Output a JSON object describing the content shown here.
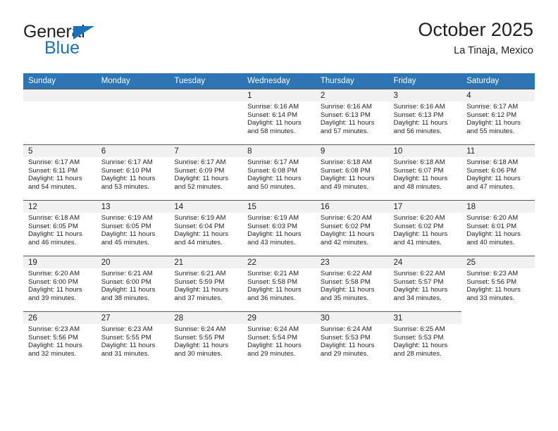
{
  "brand": {
    "name_top": "General",
    "name_bottom": "Blue",
    "accent_color": "#1b72b8"
  },
  "header": {
    "title": "October 2025",
    "subtitle": "La Tinaja, Mexico"
  },
  "theme": {
    "header_row_bg": "#2e75b6",
    "daynum_band_bg": "#f1f1f1",
    "cell_border": "#58595b",
    "text_color": "#231f20"
  },
  "weekdays": [
    "Sunday",
    "Monday",
    "Tuesday",
    "Wednesday",
    "Thursday",
    "Friday",
    "Saturday"
  ],
  "weeks": [
    [
      {
        "day": "",
        "sunrise": "",
        "sunset": "",
        "daylight_line1": "",
        "daylight_line2": "",
        "empty": true
      },
      {
        "day": "",
        "sunrise": "",
        "sunset": "",
        "daylight_line1": "",
        "daylight_line2": "",
        "empty": true
      },
      {
        "day": "",
        "sunrise": "",
        "sunset": "",
        "daylight_line1": "",
        "daylight_line2": "",
        "empty": true
      },
      {
        "day": "1",
        "sunrise": "Sunrise: 6:16 AM",
        "sunset": "Sunset: 6:14 PM",
        "daylight_line1": "Daylight: 11 hours",
        "daylight_line2": "and 58 minutes."
      },
      {
        "day": "2",
        "sunrise": "Sunrise: 6:16 AM",
        "sunset": "Sunset: 6:13 PM",
        "daylight_line1": "Daylight: 11 hours",
        "daylight_line2": "and 57 minutes."
      },
      {
        "day": "3",
        "sunrise": "Sunrise: 6:16 AM",
        "sunset": "Sunset: 6:13 PM",
        "daylight_line1": "Daylight: 11 hours",
        "daylight_line2": "and 56 minutes."
      },
      {
        "day": "4",
        "sunrise": "Sunrise: 6:17 AM",
        "sunset": "Sunset: 6:12 PM",
        "daylight_line1": "Daylight: 11 hours",
        "daylight_line2": "and 55 minutes."
      }
    ],
    [
      {
        "day": "5",
        "sunrise": "Sunrise: 6:17 AM",
        "sunset": "Sunset: 6:11 PM",
        "daylight_line1": "Daylight: 11 hours",
        "daylight_line2": "and 54 minutes."
      },
      {
        "day": "6",
        "sunrise": "Sunrise: 6:17 AM",
        "sunset": "Sunset: 6:10 PM",
        "daylight_line1": "Daylight: 11 hours",
        "daylight_line2": "and 53 minutes."
      },
      {
        "day": "7",
        "sunrise": "Sunrise: 6:17 AM",
        "sunset": "Sunset: 6:09 PM",
        "daylight_line1": "Daylight: 11 hours",
        "daylight_line2": "and 52 minutes."
      },
      {
        "day": "8",
        "sunrise": "Sunrise: 6:17 AM",
        "sunset": "Sunset: 6:08 PM",
        "daylight_line1": "Daylight: 11 hours",
        "daylight_line2": "and 50 minutes."
      },
      {
        "day": "9",
        "sunrise": "Sunrise: 6:18 AM",
        "sunset": "Sunset: 6:08 PM",
        "daylight_line1": "Daylight: 11 hours",
        "daylight_line2": "and 49 minutes."
      },
      {
        "day": "10",
        "sunrise": "Sunrise: 6:18 AM",
        "sunset": "Sunset: 6:07 PM",
        "daylight_line1": "Daylight: 11 hours",
        "daylight_line2": "and 48 minutes."
      },
      {
        "day": "11",
        "sunrise": "Sunrise: 6:18 AM",
        "sunset": "Sunset: 6:06 PM",
        "daylight_line1": "Daylight: 11 hours",
        "daylight_line2": "and 47 minutes."
      }
    ],
    [
      {
        "day": "12",
        "sunrise": "Sunrise: 6:18 AM",
        "sunset": "Sunset: 6:05 PM",
        "daylight_line1": "Daylight: 11 hours",
        "daylight_line2": "and 46 minutes."
      },
      {
        "day": "13",
        "sunrise": "Sunrise: 6:19 AM",
        "sunset": "Sunset: 6:05 PM",
        "daylight_line1": "Daylight: 11 hours",
        "daylight_line2": "and 45 minutes."
      },
      {
        "day": "14",
        "sunrise": "Sunrise: 6:19 AM",
        "sunset": "Sunset: 6:04 PM",
        "daylight_line1": "Daylight: 11 hours",
        "daylight_line2": "and 44 minutes."
      },
      {
        "day": "15",
        "sunrise": "Sunrise: 6:19 AM",
        "sunset": "Sunset: 6:03 PM",
        "daylight_line1": "Daylight: 11 hours",
        "daylight_line2": "and 43 minutes."
      },
      {
        "day": "16",
        "sunrise": "Sunrise: 6:20 AM",
        "sunset": "Sunset: 6:02 PM",
        "daylight_line1": "Daylight: 11 hours",
        "daylight_line2": "and 42 minutes."
      },
      {
        "day": "17",
        "sunrise": "Sunrise: 6:20 AM",
        "sunset": "Sunset: 6:02 PM",
        "daylight_line1": "Daylight: 11 hours",
        "daylight_line2": "and 41 minutes."
      },
      {
        "day": "18",
        "sunrise": "Sunrise: 6:20 AM",
        "sunset": "Sunset: 6:01 PM",
        "daylight_line1": "Daylight: 11 hours",
        "daylight_line2": "and 40 minutes."
      }
    ],
    [
      {
        "day": "19",
        "sunrise": "Sunrise: 6:20 AM",
        "sunset": "Sunset: 6:00 PM",
        "daylight_line1": "Daylight: 11 hours",
        "daylight_line2": "and 39 minutes."
      },
      {
        "day": "20",
        "sunrise": "Sunrise: 6:21 AM",
        "sunset": "Sunset: 6:00 PM",
        "daylight_line1": "Daylight: 11 hours",
        "daylight_line2": "and 38 minutes."
      },
      {
        "day": "21",
        "sunrise": "Sunrise: 6:21 AM",
        "sunset": "Sunset: 5:59 PM",
        "daylight_line1": "Daylight: 11 hours",
        "daylight_line2": "and 37 minutes."
      },
      {
        "day": "22",
        "sunrise": "Sunrise: 6:21 AM",
        "sunset": "Sunset: 5:58 PM",
        "daylight_line1": "Daylight: 11 hours",
        "daylight_line2": "and 36 minutes."
      },
      {
        "day": "23",
        "sunrise": "Sunrise: 6:22 AM",
        "sunset": "Sunset: 5:58 PM",
        "daylight_line1": "Daylight: 11 hours",
        "daylight_line2": "and 35 minutes."
      },
      {
        "day": "24",
        "sunrise": "Sunrise: 6:22 AM",
        "sunset": "Sunset: 5:57 PM",
        "daylight_line1": "Daylight: 11 hours",
        "daylight_line2": "and 34 minutes."
      },
      {
        "day": "25",
        "sunrise": "Sunrise: 6:23 AM",
        "sunset": "Sunset: 5:56 PM",
        "daylight_line1": "Daylight: 11 hours",
        "daylight_line2": "and 33 minutes."
      }
    ],
    [
      {
        "day": "26",
        "sunrise": "Sunrise: 6:23 AM",
        "sunset": "Sunset: 5:56 PM",
        "daylight_line1": "Daylight: 11 hours",
        "daylight_line2": "and 32 minutes."
      },
      {
        "day": "27",
        "sunrise": "Sunrise: 6:23 AM",
        "sunset": "Sunset: 5:55 PM",
        "daylight_line1": "Daylight: 11 hours",
        "daylight_line2": "and 31 minutes."
      },
      {
        "day": "28",
        "sunrise": "Sunrise: 6:24 AM",
        "sunset": "Sunset: 5:55 PM",
        "daylight_line1": "Daylight: 11 hours",
        "daylight_line2": "and 30 minutes."
      },
      {
        "day": "29",
        "sunrise": "Sunrise: 6:24 AM",
        "sunset": "Sunset: 5:54 PM",
        "daylight_line1": "Daylight: 11 hours",
        "daylight_line2": "and 29 minutes."
      },
      {
        "day": "30",
        "sunrise": "Sunrise: 6:24 AM",
        "sunset": "Sunset: 5:53 PM",
        "daylight_line1": "Daylight: 11 hours",
        "daylight_line2": "and 29 minutes."
      },
      {
        "day": "31",
        "sunrise": "Sunrise: 6:25 AM",
        "sunset": "Sunset: 5:53 PM",
        "daylight_line1": "Daylight: 11 hours",
        "daylight_line2": "and 28 minutes."
      },
      {
        "day": "",
        "sunrise": "",
        "sunset": "",
        "daylight_line1": "",
        "daylight_line2": "",
        "empty": true,
        "hide": true
      }
    ]
  ]
}
